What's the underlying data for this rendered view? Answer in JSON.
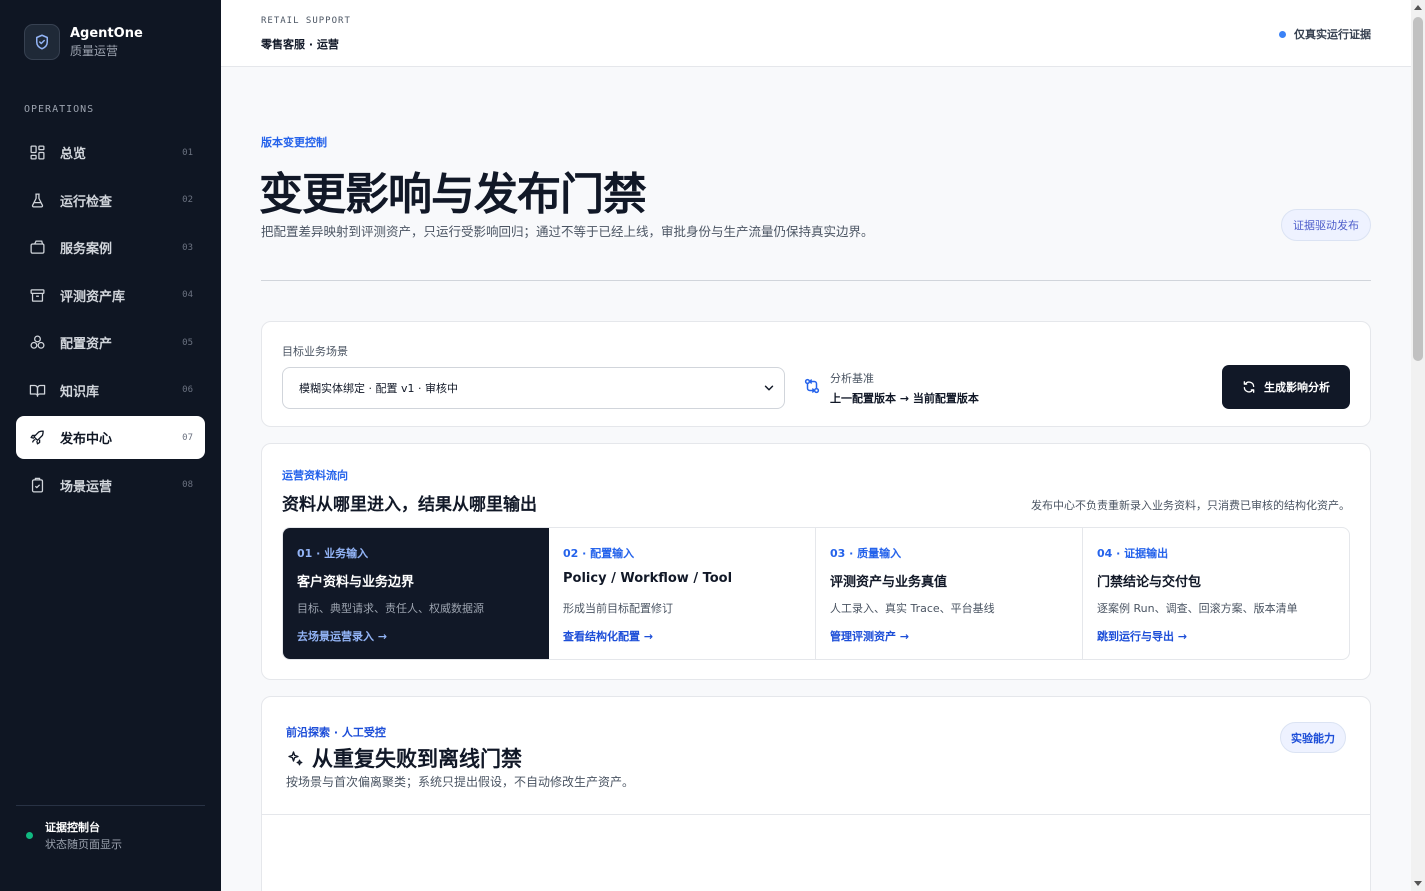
{
  "sidebar": {
    "brand_name": "AgentOne",
    "brand_sub": "质量运营",
    "section_label": "OPERATIONS",
    "items": [
      {
        "label": "总览",
        "num": "01",
        "icon": "dashboard-icon"
      },
      {
        "label": "运行检查",
        "num": "02",
        "icon": "flask-icon"
      },
      {
        "label": "服务案例",
        "num": "03",
        "icon": "briefcase-icon"
      },
      {
        "label": "评测资产库",
        "num": "04",
        "icon": "archive-icon"
      },
      {
        "label": "配置资产",
        "num": "05",
        "icon": "boxes-icon"
      },
      {
        "label": "知识库",
        "num": "06",
        "icon": "book-icon"
      },
      {
        "label": "发布中心",
        "num": "07",
        "icon": "rocket-icon",
        "active": true
      },
      {
        "label": "场景运营",
        "num": "08",
        "icon": "clipboard-check-icon"
      }
    ],
    "footer_title": "证据控制台",
    "footer_sub": "状态随页面显示"
  },
  "topbar": {
    "eyebrow": "RETAIL SUPPORT",
    "title": "零售客服 · 运营",
    "right_label": "仅真实运行证据"
  },
  "hero": {
    "eyebrow": "版本变更控制",
    "title": "变更影响与发布门禁",
    "desc": "把配置差异映射到评测资产，只运行受影响回归；通过不等于已经上线，审批身份与生产流量仍保持真实边界。",
    "badge": "证据驱动发布"
  },
  "scenario": {
    "label": "目标业务场景",
    "selected": "模糊实体绑定 · 配置 v1 · 审核中",
    "basis_label": "分析基准",
    "basis_value": "上一配置版本 → 当前配置版本",
    "button": "生成影响分析"
  },
  "flow": {
    "eyebrow": "运营资料流向",
    "title": "资料从哪里进入，结果从哪里输出",
    "note": "发布中心不负责重新录入业务资料，只消费已审核的结构化资产。",
    "steps": [
      {
        "tag": "01 · 业务输入",
        "title": "客户资料与业务边界",
        "desc": "目标、典型请求、责任人、权威数据源",
        "link": "去场景运营录入 →"
      },
      {
        "tag": "02 · 配置输入",
        "title": "Policy / Workflow / Tool",
        "desc": "形成当前目标配置修订",
        "link": "查看结构化配置 →"
      },
      {
        "tag": "03 · 质量输入",
        "title": "评测资产与业务真值",
        "desc": "人工录入、真实 Trace、平台基线",
        "link": "管理评测资产 →"
      },
      {
        "tag": "04 · 证据输出",
        "title": "门禁结论与交付包",
        "desc": "逐案例 Run、调查、回滚方案、版本清单",
        "link": "跳到运行与导出 →"
      }
    ]
  },
  "explore": {
    "eyebrow": "前沿探索 · 人工受控",
    "title": "从重复失败到离线门禁",
    "desc": "按场景与首次偏离聚类；系统只提出假设，不自动修改生产资产。",
    "badge": "实验能力"
  },
  "colors": {
    "sidebar_bg": "#0f1623",
    "accent": "#2563eb",
    "primary_button": "#111827",
    "status_green": "#10b981"
  }
}
